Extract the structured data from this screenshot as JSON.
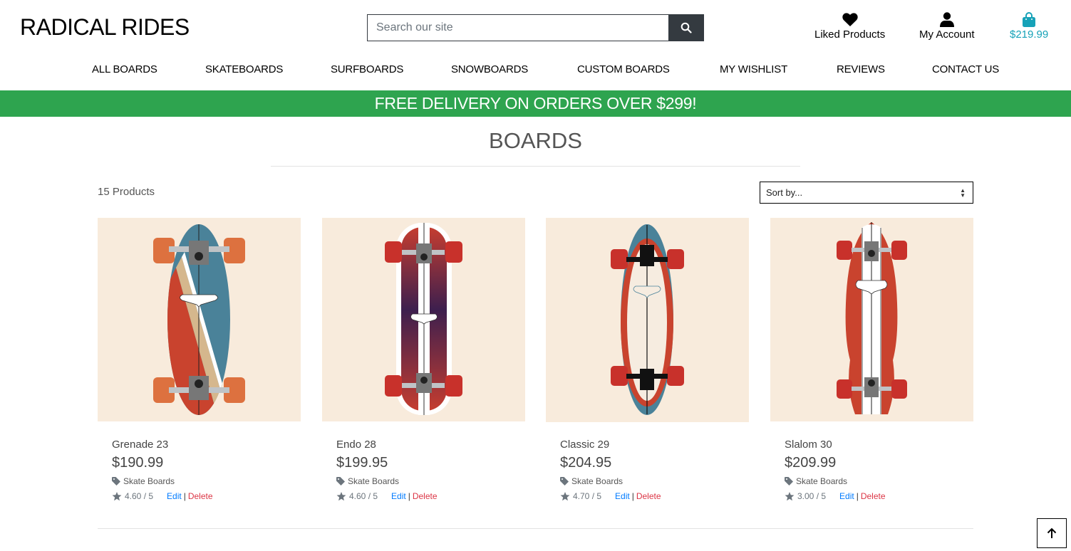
{
  "header": {
    "logo": "RADICAL RIDES",
    "search_placeholder": "Search our site",
    "search_icon": "search-icon",
    "liked": {
      "label": "Liked Products",
      "icon": "heart-icon"
    },
    "account": {
      "label": "My Account",
      "icon": "user-icon"
    },
    "bag": {
      "label": "$219.99",
      "icon": "shopping-bag-icon",
      "color": "#17a2b8"
    }
  },
  "nav": {
    "items": [
      {
        "label": "ALL BOARDS"
      },
      {
        "label": "SKATEBOARDS"
      },
      {
        "label": "SURFBOARDS"
      },
      {
        "label": "SNOWBOARDS"
      },
      {
        "label": "CUSTOM BOARDS"
      },
      {
        "label": "MY WISHLIST"
      },
      {
        "label": "REVIEWS"
      },
      {
        "label": "CONTACT US"
      }
    ]
  },
  "banner": {
    "text": "FREE DELIVERY ON ORDERS OVER $299!",
    "color": "#2ea44f"
  },
  "main": {
    "title": "BOARDS",
    "count": "15 Products",
    "sort": {
      "selected": "Sort by..."
    },
    "products": [
      {
        "name": "Grenade 23",
        "price": "$190.99",
        "category": "Skate Boards",
        "rating": "4.60 / 5",
        "edit": "Edit",
        "sep": "|",
        "delete": "Delete",
        "image_alt": "Grenade 23 skateboard, blue deck with red and tan stripes"
      },
      {
        "name": "Endo 28",
        "price": "$199.95",
        "category": "Skate Boards",
        "rating": "4.60 / 5",
        "edit": "Edit",
        "sep": "|",
        "delete": "Delete",
        "image_alt": "Endo 28 skateboard, red-to-purple gradient deck with white stripe"
      },
      {
        "name": "Classic 29",
        "price": "$204.95",
        "category": "Skate Boards",
        "rating": "4.70 / 5",
        "edit": "Edit",
        "sep": "|",
        "delete": "Delete",
        "image_alt": "Classic 29 skateboard, cream deck with red and blue rails"
      },
      {
        "name": "Slalom 30",
        "price": "$209.99",
        "category": "Skate Boards",
        "rating": "3.00 / 5",
        "edit": "Edit",
        "sep": "|",
        "delete": "Delete",
        "image_alt": "Slalom 30 skateboard, red deck with white center stripe"
      }
    ]
  },
  "back_to_top": {
    "icon": "arrow-up-icon"
  }
}
